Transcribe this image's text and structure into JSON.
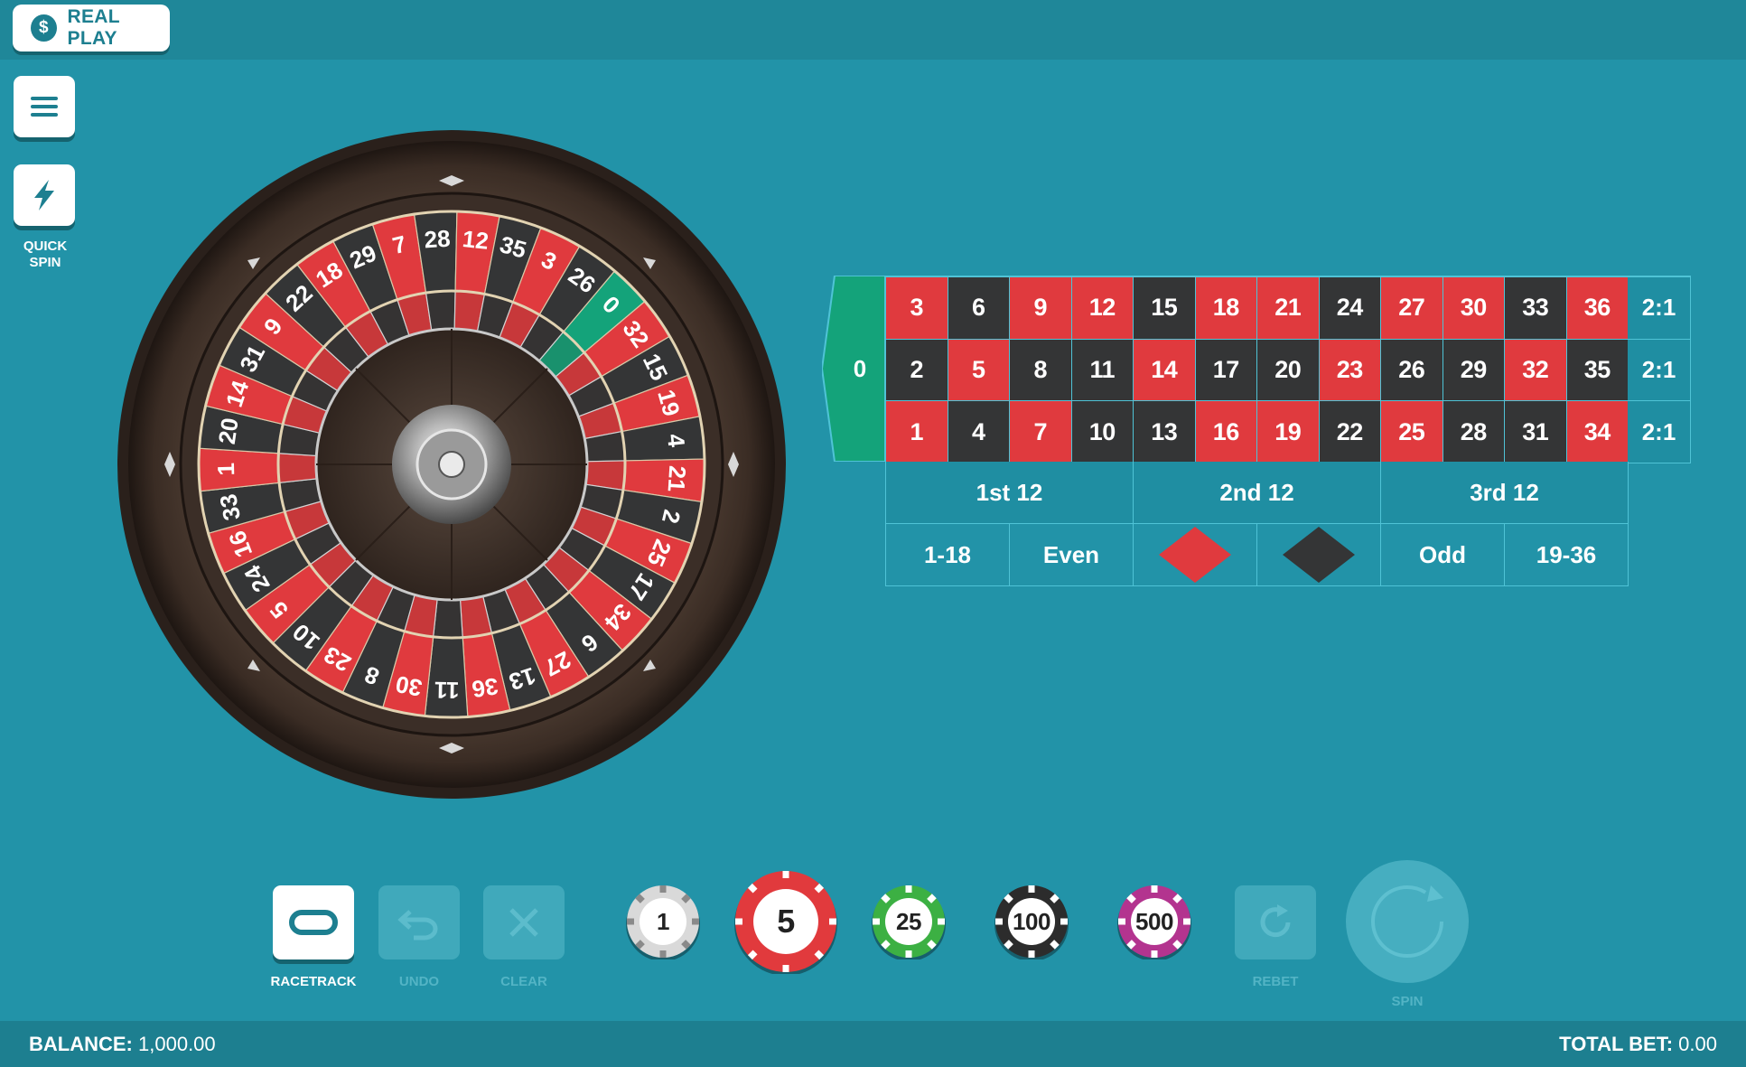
{
  "header": {
    "mode_label": "REAL PLAY",
    "mode_icon": "dollar-icon"
  },
  "sidebar": {
    "menu_icon": "hamburger-icon",
    "quick_spin_icon": "lightning-icon",
    "quick_spin_label": "QUICK\nSPIN"
  },
  "wheel": {
    "pockets": [
      {
        "n": "0",
        "c": "green"
      },
      {
        "n": "32",
        "c": "red"
      },
      {
        "n": "15",
        "c": "black"
      },
      {
        "n": "19",
        "c": "red"
      },
      {
        "n": "4",
        "c": "black"
      },
      {
        "n": "21",
        "c": "red"
      },
      {
        "n": "2",
        "c": "black"
      },
      {
        "n": "25",
        "c": "red"
      },
      {
        "n": "17",
        "c": "black"
      },
      {
        "n": "34",
        "c": "red"
      },
      {
        "n": "6",
        "c": "black"
      },
      {
        "n": "27",
        "c": "red"
      },
      {
        "n": "13",
        "c": "black"
      },
      {
        "n": "36",
        "c": "red"
      },
      {
        "n": "11",
        "c": "black"
      },
      {
        "n": "30",
        "c": "red"
      },
      {
        "n": "8",
        "c": "black"
      },
      {
        "n": "23",
        "c": "red"
      },
      {
        "n": "10",
        "c": "black"
      },
      {
        "n": "5",
        "c": "red"
      },
      {
        "n": "24",
        "c": "black"
      },
      {
        "n": "16",
        "c": "red"
      },
      {
        "n": "33",
        "c": "black"
      },
      {
        "n": "1",
        "c": "red"
      },
      {
        "n": "20",
        "c": "black"
      },
      {
        "n": "14",
        "c": "red"
      },
      {
        "n": "31",
        "c": "black"
      },
      {
        "n": "9",
        "c": "red"
      },
      {
        "n": "22",
        "c": "black"
      },
      {
        "n": "18",
        "c": "red"
      },
      {
        "n": "29",
        "c": "black"
      },
      {
        "n": "7",
        "c": "red"
      },
      {
        "n": "28",
        "c": "black"
      },
      {
        "n": "12",
        "c": "red"
      },
      {
        "n": "35",
        "c": "black"
      },
      {
        "n": "3",
        "c": "red"
      },
      {
        "n": "26",
        "c": "black"
      }
    ]
  },
  "table": {
    "zero": "0",
    "rows": [
      [
        {
          "n": "3",
          "c": "red"
        },
        {
          "n": "6",
          "c": "black"
        },
        {
          "n": "9",
          "c": "red"
        },
        {
          "n": "12",
          "c": "red"
        },
        {
          "n": "15",
          "c": "black"
        },
        {
          "n": "18",
          "c": "red"
        },
        {
          "n": "21",
          "c": "red"
        },
        {
          "n": "24",
          "c": "black"
        },
        {
          "n": "27",
          "c": "red"
        },
        {
          "n": "30",
          "c": "red"
        },
        {
          "n": "33",
          "c": "black"
        },
        {
          "n": "36",
          "c": "red"
        }
      ],
      [
        {
          "n": "2",
          "c": "black"
        },
        {
          "n": "5",
          "c": "red"
        },
        {
          "n": "8",
          "c": "black"
        },
        {
          "n": "11",
          "c": "black"
        },
        {
          "n": "14",
          "c": "red"
        },
        {
          "n": "17",
          "c": "black"
        },
        {
          "n": "20",
          "c": "black"
        },
        {
          "n": "23",
          "c": "red"
        },
        {
          "n": "26",
          "c": "black"
        },
        {
          "n": "29",
          "c": "black"
        },
        {
          "n": "32",
          "c": "red"
        },
        {
          "n": "35",
          "c": "black"
        }
      ],
      [
        {
          "n": "1",
          "c": "red"
        },
        {
          "n": "4",
          "c": "black"
        },
        {
          "n": "7",
          "c": "red"
        },
        {
          "n": "10",
          "c": "black"
        },
        {
          "n": "13",
          "c": "black"
        },
        {
          "n": "16",
          "c": "red"
        },
        {
          "n": "19",
          "c": "red"
        },
        {
          "n": "22",
          "c": "black"
        },
        {
          "n": "25",
          "c": "red"
        },
        {
          "n": "28",
          "c": "black"
        },
        {
          "n": "31",
          "c": "black"
        },
        {
          "n": "34",
          "c": "red"
        }
      ]
    ],
    "column_bets": [
      "2:1",
      "2:1",
      "2:1"
    ],
    "dozens": [
      "1st 12",
      "2nd 12",
      "3rd 12"
    ],
    "even_money": {
      "low": "1-18",
      "even": "Even",
      "red_icon": "red-diamond-icon",
      "black_icon": "black-diamond-icon",
      "odd": "Odd",
      "high": "19-36"
    }
  },
  "controls": {
    "racetrack_label": "RACETRACK",
    "undo_label": "UNDO",
    "clear_label": "CLEAR",
    "rebet_label": "REBET",
    "spin_label": "SPIN"
  },
  "chips": [
    {
      "value": "1",
      "color": "#d9d9d9",
      "stripe": "#8a8a8a",
      "selected": false
    },
    {
      "value": "5",
      "color": "#e13a3d",
      "stripe": "#ffffff",
      "selected": true
    },
    {
      "value": "25",
      "color": "#3cb043",
      "stripe": "#ffffff",
      "selected": false
    },
    {
      "value": "100",
      "color": "#2c2c2c",
      "stripe": "#ffffff",
      "selected": false
    },
    {
      "value": "500",
      "color": "#b3348f",
      "stripe": "#ffffff",
      "selected": false
    }
  ],
  "footer": {
    "balance_label": "BALANCE:",
    "balance_value": "1,000.00",
    "total_bet_label": "TOTAL BET:",
    "total_bet_value": "0.00"
  },
  "colors": {
    "felt": "#2293a8",
    "red": "#e03a3e",
    "black": "#343536",
    "green": "#14a37a"
  }
}
